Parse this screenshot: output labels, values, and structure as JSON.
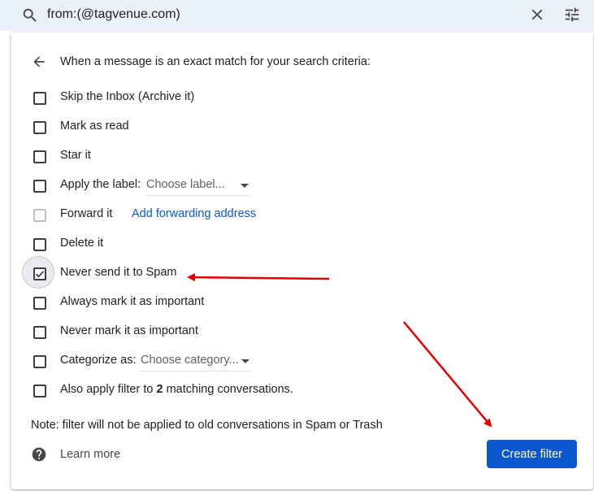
{
  "search": {
    "query": "from:(@tagvenue.com)",
    "search_icon": "search-icon",
    "close_icon": "close-icon",
    "options_icon": "tune-icon"
  },
  "filter": {
    "back_icon": "arrow-back-icon",
    "header": "When a message is an exact match for your search criteria:",
    "options": [
      {
        "label": "Skip the Inbox (Archive it)",
        "checked": false
      },
      {
        "label": "Mark as read",
        "checked": false
      },
      {
        "label": "Star it",
        "checked": false
      },
      {
        "label": "Apply the label:",
        "checked": false,
        "select": "Choose label..."
      },
      {
        "label": "Forward it",
        "checked": false,
        "disabled": true,
        "link": "Add forwarding address"
      },
      {
        "label": "Delete it",
        "checked": false
      },
      {
        "label": "Never send it to Spam",
        "checked": true
      },
      {
        "label": "Always mark it as important",
        "checked": false
      },
      {
        "label": "Never mark it as important",
        "checked": false
      },
      {
        "label": "Categorize as:",
        "checked": false,
        "select": "Choose category..."
      },
      {
        "label_prefix": "Also apply filter to ",
        "count": "2",
        "label_suffix": " matching conversations.",
        "checked": false
      }
    ],
    "note": "Note: filter will not be applied to old conversations in Spam or Trash",
    "learn_more": "Learn more",
    "help_icon": "help-icon",
    "create_button": "Create filter"
  },
  "colors": {
    "accent": "#0b57d0",
    "annotation_arrow": "#e00000",
    "searchbar_bg": "#eaf1fb"
  }
}
